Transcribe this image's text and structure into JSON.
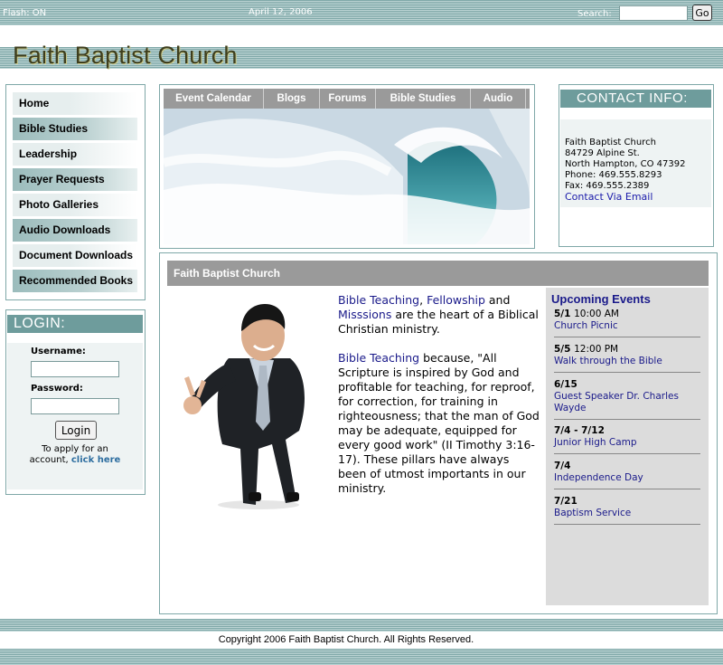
{
  "topbar": {
    "flash": "Flash: ON",
    "date": "April 12, 2006",
    "search_label": "Search:",
    "search_value": "",
    "go_label": "Go"
  },
  "site": {
    "title": "Faith Baptist Church"
  },
  "nav": {
    "items": [
      {
        "label": "Home"
      },
      {
        "label": "Bible Studies"
      },
      {
        "label": "Leadership"
      },
      {
        "label": "Prayer Requests"
      },
      {
        "label": "Photo Galleries"
      },
      {
        "label": "Audio Downloads"
      },
      {
        "label": "Document Downloads"
      },
      {
        "label": "Recommended Books"
      }
    ]
  },
  "login": {
    "title": "LOGIN:",
    "username_label": "Username:",
    "password_label": "Password:",
    "button_label": "Login",
    "apply_text": "To apply for an",
    "apply_text2": "account,",
    "apply_link": "click here"
  },
  "tabs": [
    {
      "label": "Event Calendar"
    },
    {
      "label": "Blogs"
    },
    {
      "label": "Forums"
    },
    {
      "label": "Bible Studies"
    },
    {
      "label": "Audio"
    }
  ],
  "contact": {
    "title": "CONTACT INFO:",
    "lines": [
      "Faith Baptist Church",
      "84729 Alpine St.",
      "North Hampton, CO  47392",
      "Phone: 469.555.8293",
      "Fax: 469.555.2389"
    ],
    "link": "Contact Via Email"
  },
  "main": {
    "heading": "Faith Baptist Church",
    "p1_a": "Bible Teaching",
    "p1_b": ", ",
    "p1_c": "Fellowship",
    "p1_d": " and ",
    "p1_e": "Misssions",
    "p1_f": " are the heart of a Biblical Christian ministry.",
    "p2_a": "Bible Teaching",
    "p2_b": "  because, \"All Scripture is inspired by God and profitable for teaching, for reproof, for correction, for training in righteousness; that the man of God may be adequate, equipped for every good work\" (II Timothy 3:16-17).  These pillars have always been of utmost importants in our ministry."
  },
  "events": {
    "title": "Upcoming Events",
    "items": [
      {
        "date": "5/1",
        "time": "10:00 AM",
        "title": "Church Picnic"
      },
      {
        "date": "5/5",
        "time": "12:00 PM",
        "title": "Walk through the Bible"
      },
      {
        "date": "6/15",
        "time": "",
        "title": "Guest Speaker Dr. Charles Wayde"
      },
      {
        "date": "7/4 - 7/12",
        "time": "",
        "title": "Junior High Camp"
      },
      {
        "date": "7/4",
        "time": "",
        "title": "Independence Day"
      },
      {
        "date": "7/21",
        "time": "",
        "title": "Baptism Service"
      }
    ]
  },
  "footer": {
    "copyright": "Copyright 2006 Faith Baptist Church. All Rights Reserved."
  }
}
